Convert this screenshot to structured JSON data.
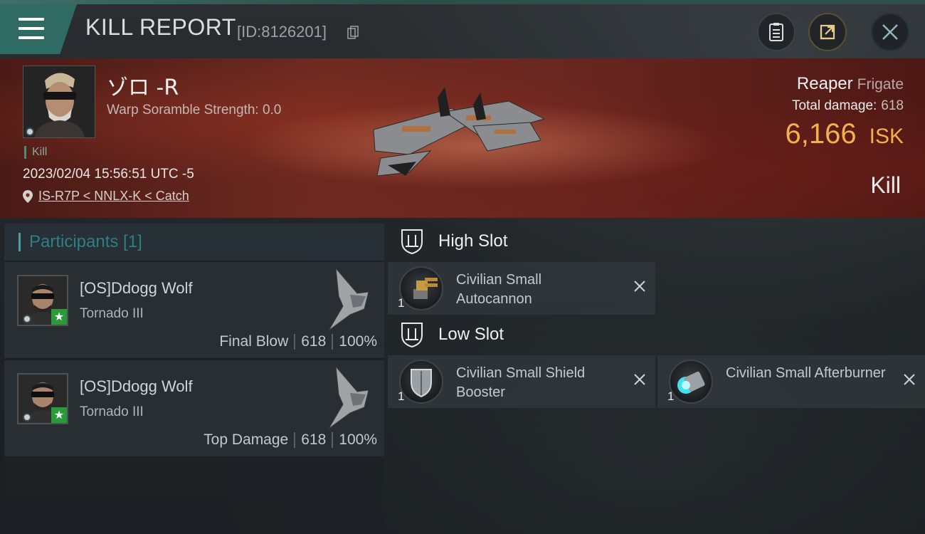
{
  "header": {
    "title": "KILL REPORT",
    "report_id": "[ID:8126201]"
  },
  "victim": {
    "name": "ゾロ -R",
    "warp_scramble": "Warp Soramble Strength: 0.0",
    "kill_tag": "Kill",
    "datetime": "2023/02/04 15:56:51 UTC -5",
    "location": "IS-R7P < NNLX-K < Catch",
    "ship_name": "Reaper",
    "ship_class": "Frigate",
    "total_damage_label": "Total damage:",
    "total_damage_value": "618",
    "isk_value": "6,166",
    "isk_unit": "ISK",
    "result": "Kill"
  },
  "participants": {
    "header": "Participants [1]",
    "rows": [
      {
        "name": "[OS]Ddogg Wolf",
        "ship": "Tornado III",
        "role": "Final Blow",
        "damage": "618",
        "percent": "100%"
      },
      {
        "name": "[OS]Ddogg Wolf",
        "ship": "Tornado III",
        "role": "Top Damage",
        "damage": "618",
        "percent": "100%"
      }
    ]
  },
  "slots": {
    "high": {
      "label": "High Slot",
      "modules": [
        {
          "name": "Civilian Small Autocannon",
          "qty": "1",
          "icon": "autocannon-icon"
        }
      ]
    },
    "low": {
      "label": "Low Slot",
      "modules": [
        {
          "name": "Civilian Small Shield Booster",
          "qty": "1",
          "icon": "shield-booster-icon"
        },
        {
          "name": "Civilian Small Afterburner",
          "qty": "1",
          "icon": "afterburner-icon"
        }
      ]
    }
  },
  "colors": {
    "accent_teal": "#2f6b62",
    "isk_gold": "#f3b14b",
    "participants_label": "#2f7e84"
  }
}
